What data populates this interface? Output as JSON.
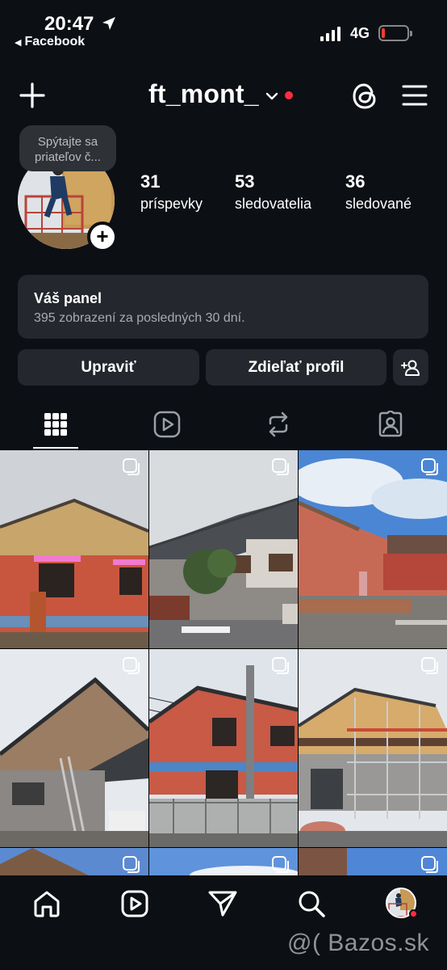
{
  "status_bar": {
    "time": "20:47",
    "back_app": "Facebook",
    "network": "4G",
    "battery_level": 0.12,
    "battery_color": "#ff3b30"
  },
  "header": {
    "username": "ft_mont_",
    "icons": [
      "plus-icon",
      "chevron-down-icon",
      "threads-icon",
      "menu-icon"
    ],
    "notification_dot_color": "#ff2d3f"
  },
  "profile": {
    "note": "Spýtajte sa priateľov č...",
    "stats": [
      {
        "value": "31",
        "label": "príspevky"
      },
      {
        "value": "53",
        "label": "sledovatelia"
      },
      {
        "value": "36",
        "label": "sledované"
      }
    ]
  },
  "panel": {
    "title": "Váš panel",
    "subtitle": "395 zobrazení za posledných 30 dní."
  },
  "actions": {
    "edit_label": "Upraviť",
    "share_label": "Zdieľať profil"
  },
  "tabs": [
    {
      "name": "grid-icon",
      "active": true
    },
    {
      "name": "reels-icon",
      "active": false
    },
    {
      "name": "repost-icon",
      "active": false
    },
    {
      "name": "tagged-icon",
      "active": false
    }
  ],
  "grid": {
    "tiles_visible": 9,
    "multi_photo_icon": "multiple-photos-icon"
  },
  "bottom_nav": [
    "home-icon",
    "reels-icon",
    "direct-icon",
    "search-icon",
    "profile-avatar"
  ],
  "watermark": "@( Bazos.sk"
}
